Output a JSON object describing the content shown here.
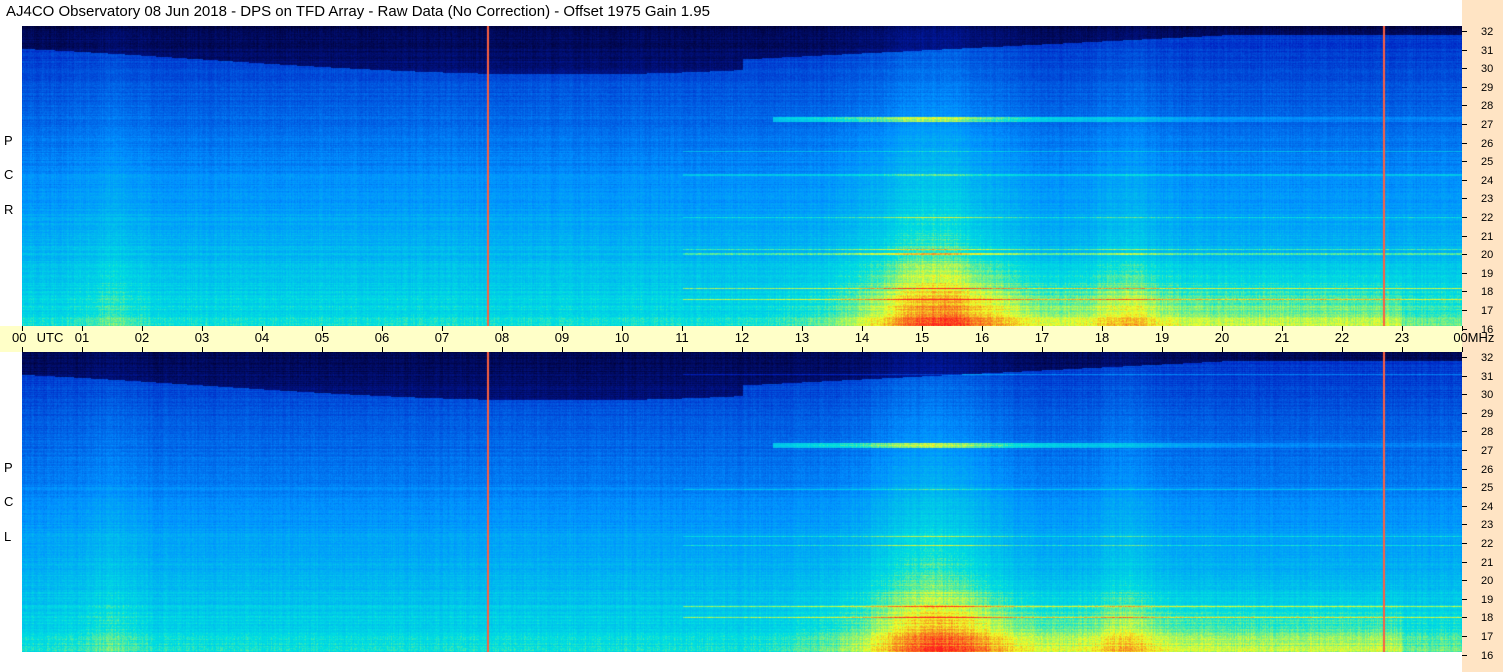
{
  "title": "AJ4CO Observatory  08 Jun 2018  -  DPS on TFD Array  -  Raw Data (No Correction)  -  Offset 1975  Gain 1.95",
  "panels": [
    {
      "polarization": [
        "R",
        "C",
        "P"
      ]
    },
    {
      "polarization": [
        "L",
        "C",
        "P"
      ]
    }
  ],
  "freq_ticks": [
    "32",
    "31",
    "30",
    "29",
    "28",
    "27",
    "26",
    "25",
    "24",
    "23",
    "22",
    "21",
    "20",
    "19",
    "18",
    "17",
    "16"
  ],
  "time_axis": {
    "first_label": "00",
    "utc_label": "UTC",
    "hours": [
      "01",
      "02",
      "03",
      "04",
      "05",
      "06",
      "07",
      "08",
      "09",
      "10",
      "11",
      "12",
      "13",
      "14",
      "15",
      "16",
      "17",
      "18",
      "19",
      "20",
      "21",
      "22",
      "23"
    ],
    "last_label": "00",
    "unit_label": "MHz"
  },
  "colors": {
    "title_bg": "#ffffff",
    "time_axis_bg": "#ffffc8",
    "freq_axis_bg": "#ffe4c4",
    "colormap": [
      "#000030",
      "#0020c0",
      "#0090ff",
      "#00e0e0",
      "#ffff00",
      "#ff0000"
    ]
  }
}
